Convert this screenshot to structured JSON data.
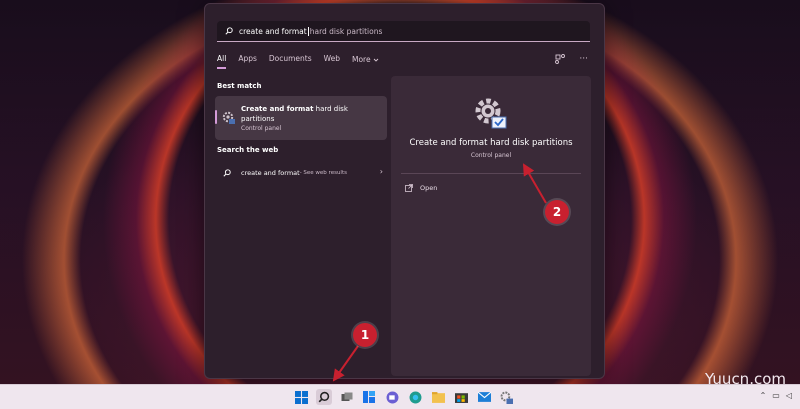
{
  "search": {
    "typed": "create and format ",
    "suggestion": "hard disk partitions"
  },
  "tabs": [
    {
      "label": "All"
    },
    {
      "label": "Apps"
    },
    {
      "label": "Documents"
    },
    {
      "label": "Web"
    },
    {
      "label": "More"
    }
  ],
  "top_icons": {
    "share": "share-icon",
    "more": "···"
  },
  "best_match": {
    "heading": "Best match",
    "title_bold": "Create and format",
    "title_rest": " hard disk partitions",
    "subtitle": "Control panel"
  },
  "web": {
    "heading": "Search the web",
    "query": "create and format",
    "suffix": " - See web results"
  },
  "detail": {
    "title": "Create and format hard disk partitions",
    "subtitle": "Control panel",
    "open_label": "Open"
  },
  "markers": [
    {
      "label": "1"
    },
    {
      "label": "2"
    }
  ],
  "watermark": "Yuucn.com",
  "colors": {
    "accent": "#d49bd8",
    "marker": "#c8202f",
    "panel": "#2d1f2c"
  }
}
